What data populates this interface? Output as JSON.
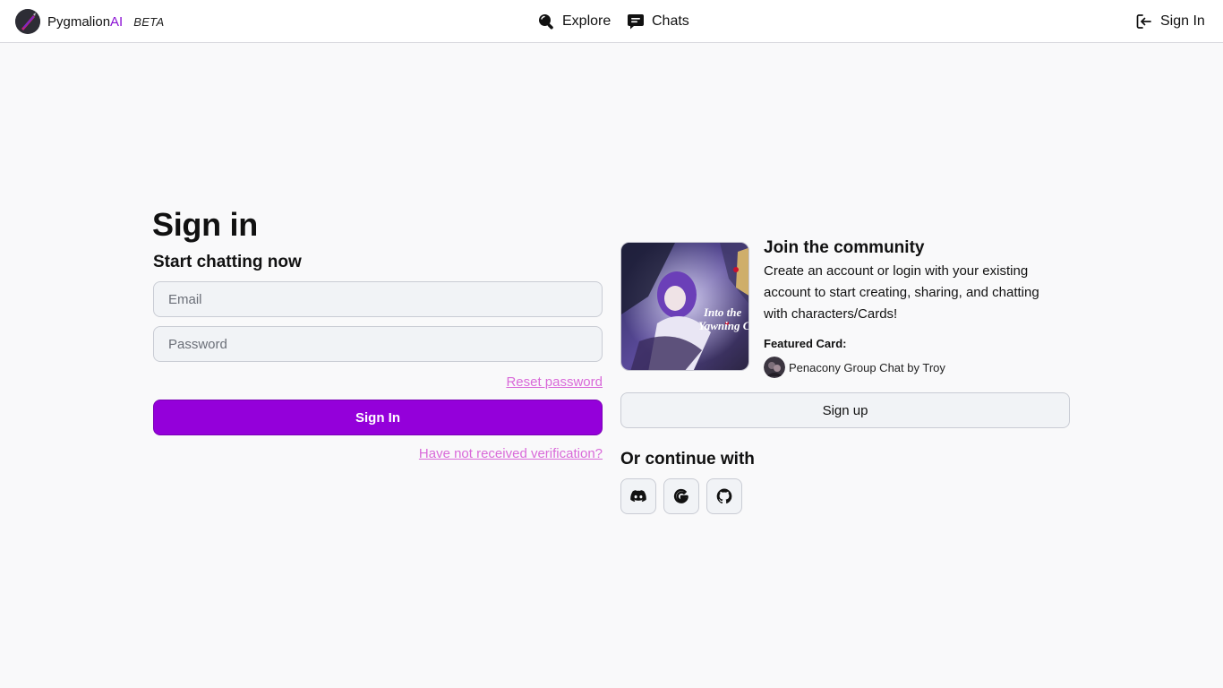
{
  "header": {
    "brand_name": "Pygmalion",
    "brand_suffix": "AI",
    "brand_beta": "BETA",
    "nav": {
      "explore": "Explore",
      "chats": "Chats",
      "signin": "Sign In"
    },
    "icons": [
      "search-icon",
      "chat-bubble-icon",
      "login-icon"
    ]
  },
  "signin": {
    "title": "Sign in",
    "subtitle": "Start chatting now",
    "email_placeholder": "Email",
    "password_placeholder": "Password",
    "reset_label": "Reset password",
    "submit_label": "Sign In",
    "verify_label": "Have not received verification?"
  },
  "community": {
    "title": "Join the community",
    "description": "Create an account or login with your existing account to start creating, sharing, and chatting with characters/Cards!",
    "featured_label": "Featured Card:",
    "featured_card": "Penacony Group Chat by Troy",
    "card_image_text": "Into the Yawning C",
    "signup_label": "Sign up",
    "continue_title": "Or continue with",
    "social": [
      "discord-icon",
      "google-icon",
      "github-icon"
    ]
  },
  "colors": {
    "accent": "#9400da",
    "link": "#d96ad9",
    "brand_ai": "#8b12d4",
    "background": "#f9f9fa"
  }
}
